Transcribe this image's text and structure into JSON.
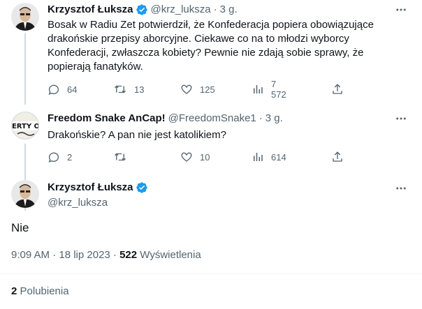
{
  "tweet1": {
    "name": "Krzysztof Łuksza",
    "handle": "@krz_luksza",
    "separator": "·",
    "time": "3 g.",
    "text": "Bosak w Radiu Zet potwierdził, że Konfederacja popiera obowiązujące drakońskie przepisy aborcyjne. Ciekawe co na to młodzi wyborcy Konfederacji, zwłaszcza kobiety? Pewnie nie zdają sobie sprawy, że popierają fanatyków.",
    "replies": "64",
    "retweets": "13",
    "likes": "125",
    "views": "7 572"
  },
  "tweet2": {
    "name": "Freedom Snake AnCap!",
    "handle": "@FreedomSnake1",
    "separator": "·",
    "time": "3 g.",
    "avatar_text": "ERTY O",
    "text": "Drakońskie? A pan nie jest katolikiem?",
    "replies": "2",
    "retweets": "",
    "likes": "10",
    "views": "614"
  },
  "main": {
    "name": "Krzysztof Łuksza",
    "handle": "@krz_luksza",
    "text": "Nie",
    "timestamp": "9:09 AM · 18 lip 2023 · ",
    "views_count": "522",
    "views_label": " Wyświetlenia",
    "likes_count": "2",
    "likes_label": " Polubienia"
  },
  "colors": {
    "verified": "#1d9bf0",
    "secondary_text": "#536471",
    "primary_text": "#0f1419"
  }
}
